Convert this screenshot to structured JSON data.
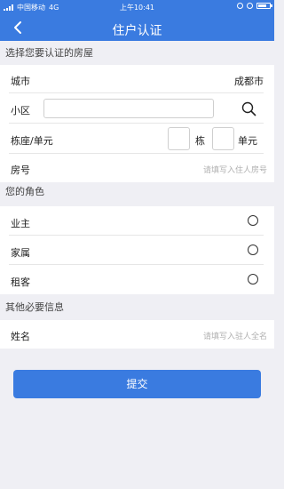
{
  "status_bar": {
    "carrier": "中国移动",
    "network": "4G",
    "time": "上午10:41"
  },
  "nav": {
    "title": "住户认证",
    "back_icon": "chevron-left-icon"
  },
  "sections": {
    "house": "选择您要认证的房屋",
    "role": "您的角色",
    "other": "其他必要信息"
  },
  "form": {
    "city": {
      "label": "城市",
      "value": "成都市"
    },
    "community": {
      "label": "小区",
      "value": "",
      "search_icon": "search-icon"
    },
    "building": {
      "label": "栋座/单元",
      "building_value": "",
      "building_suffix": "栋",
      "unit_value": "",
      "unit_suffix": "单元"
    },
    "room": {
      "label": "房号",
      "placeholder": "请填写入住人房号"
    },
    "roles": [
      {
        "label": "业主",
        "selected": false
      },
      {
        "label": "家属",
        "selected": false
      },
      {
        "label": "租客",
        "selected": false
      }
    ],
    "name": {
      "label": "姓名",
      "placeholder": "请填写入驻人全名"
    }
  },
  "submit_label": "提交",
  "colors": {
    "primary": "#3a7be0",
    "background": "#efeff4"
  }
}
